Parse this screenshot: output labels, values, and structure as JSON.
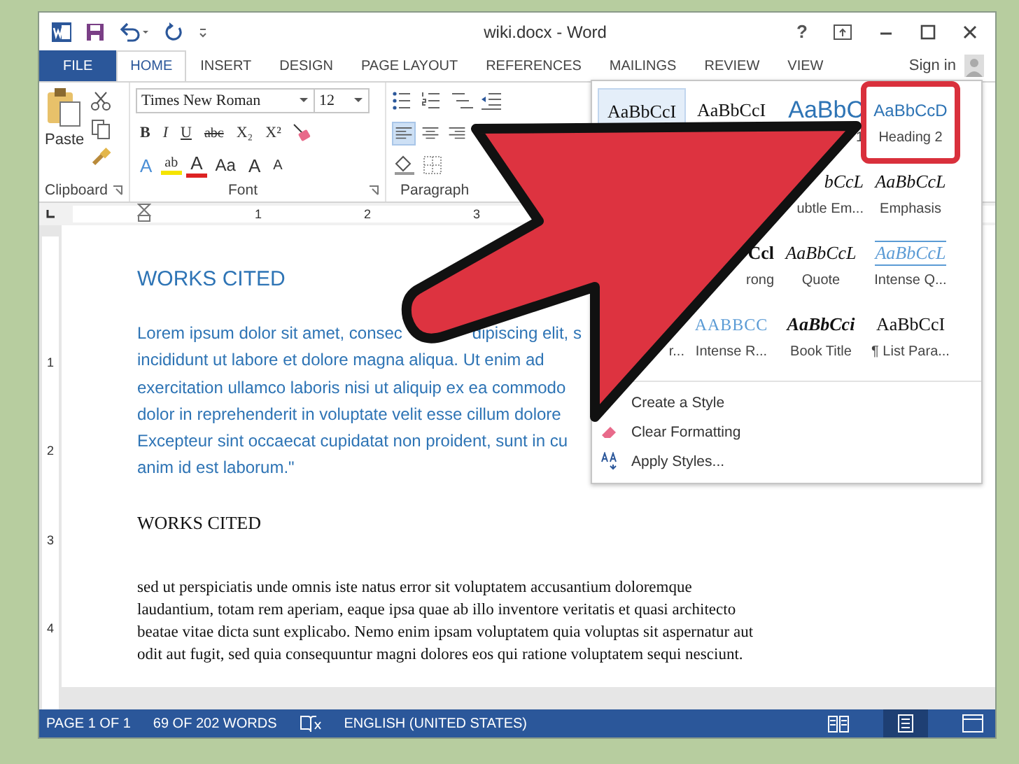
{
  "window": {
    "title": "wiki.docx - Word",
    "help": "?"
  },
  "tabs": [
    {
      "label": "FILE",
      "kind": "file",
      "selected": false
    },
    {
      "label": "HOME",
      "kind": "tab",
      "selected": true
    },
    {
      "label": "INSERT",
      "kind": "tab",
      "selected": false
    },
    {
      "label": "DESIGN",
      "kind": "tab",
      "selected": false
    },
    {
      "label": "PAGE LAYOUT",
      "kind": "tab",
      "selected": false
    },
    {
      "label": "REFERENCES",
      "kind": "tab",
      "selected": false
    },
    {
      "label": "MAILINGS",
      "kind": "tab",
      "selected": false
    },
    {
      "label": "REVIEW",
      "kind": "tab",
      "selected": false
    },
    {
      "label": "VIEW",
      "kind": "tab",
      "selected": false
    }
  ],
  "sign_in": "Sign in",
  "clipboard": {
    "paste": "Paste",
    "label": "Clipboard"
  },
  "font": {
    "family": "Times New Roman",
    "size": "12",
    "label": "Font",
    "format_buttons": [
      {
        "text": "B",
        "kind": "bold"
      },
      {
        "text": "I",
        "kind": "italic"
      },
      {
        "text": "U",
        "kind": "underline"
      },
      {
        "text": "abc",
        "kind": "strike"
      },
      {
        "text": "X₂",
        "kind": "sub"
      },
      {
        "text": "X²",
        "kind": "sup"
      }
    ],
    "effect_buttons": [
      {
        "text": "A",
        "kind": "effects"
      },
      {
        "text": "ab",
        "kind": "highlight"
      },
      {
        "text": "A",
        "kind": "color"
      },
      {
        "text": "Aa",
        "kind": "case"
      },
      {
        "text": "A",
        "kind": "grow"
      },
      {
        "text": "A",
        "kind": "shrink"
      }
    ]
  },
  "paragraph": {
    "label": "Paragraph",
    "alignments": [
      {
        "kind": "left",
        "selected": true
      },
      {
        "kind": "center",
        "selected": false
      },
      {
        "kind": "right",
        "selected": false
      }
    ]
  },
  "ruler": {
    "marks": [
      "1",
      "2",
      "3"
    ]
  },
  "vertical_ruler": {
    "marks": [
      "1",
      "2",
      "3",
      "4"
    ]
  },
  "document": {
    "heading": "WORKS CITED",
    "paragraph_lines": [
      [
        "Lorem ipsum dolor sit amet, consec",
        "dipiscing elit, s"
      ],
      [
        "incididunt ut labore et dolore magna aliqua. Ut enim ad"
      ],
      [
        "exercitation ullamco laboris nisi ut aliquip ex ea commodo"
      ],
      [
        "dolor in reprehenderit in voluptate velit esse cillum dolore"
      ],
      [
        "Excepteur sint occaecat cupidatat non proident, sunt in cu"
      ],
      [
        "anim id est laborum.\""
      ]
    ],
    "heading_2": "WORKS CITED",
    "body_lines": [
      "sed ut perspiciatis unde omnis iste natus error sit voluptatem accusantium doloremque",
      "laudantium, totam rem aperiam, eaque ipsa quae ab illo inventore veritatis et quasi architecto",
      "beatae vitae dicta sunt explicabo. Nemo enim ipsam voluptatem quia voluptas sit aspernatur aut",
      "odit aut fugit, sed quia consequuntur magni dolores eos qui ratione voluptatem sequi nesciunt."
    ]
  },
  "styles_gallery": {
    "rows": [
      [
        {
          "sample": "AaBbCcI",
          "kind": "normal",
          "selected": true,
          "highlighted": false,
          "cut": false
        },
        {
          "sample": "AaBbCcI",
          "kind": "normal",
          "selected": false,
          "highlighted": false,
          "cut": false
        },
        {
          "sample": "AaBbC",
          "label": "1",
          "kind": "heading1",
          "selected": false,
          "highlighted": false,
          "cut": true
        },
        {
          "sample": "AaBbCcD",
          "label": "Heading 2",
          "kind": "heading2",
          "selected": false,
          "highlighted": true,
          "cut": false
        }
      ],
      [
        null,
        null,
        {
          "sample": "bCcL",
          "label": "ubtle Em...",
          "kind": "emphasis",
          "selected": false,
          "highlighted": false,
          "cut": true
        },
        {
          "sample": "AaBbCcL",
          "label": "Emphasis",
          "kind": "emphasis",
          "selected": false,
          "highlighted": false,
          "cut": false
        }
      ],
      [
        null,
        {
          "sample": "Ccl",
          "label": "rong",
          "kind": "strong",
          "selected": false,
          "highlighted": false,
          "cut": true
        },
        {
          "sample": "AaBbCcL",
          "label": "Quote",
          "kind": "emphasis",
          "selected": false,
          "highlighted": false,
          "cut": false
        },
        {
          "sample": "AaBbCcL",
          "label": "Intense Q...",
          "kind": "intense_quote",
          "selected": false,
          "highlighted": false,
          "cut": false
        }
      ],
      [
        {
          "label": "r...",
          "kind": "normal",
          "selected": false,
          "highlighted": false,
          "cut": true
        },
        {
          "sample": "AABBCC",
          "label": "Intense R...",
          "kind": "intense_ref",
          "selected": false,
          "highlighted": false,
          "cut": false
        },
        {
          "sample": "AaBbCci",
          "label": "Book Title",
          "kind": "book_title",
          "selected": false,
          "highlighted": false,
          "cut": false
        },
        {
          "sample": "AaBbCcI",
          "label": "¶ List Para...",
          "kind": "normal",
          "selected": false,
          "highlighted": false,
          "cut": false
        }
      ]
    ],
    "menu": [
      {
        "label": "Create a Style",
        "kind": "create"
      },
      {
        "label": "Clear Formatting",
        "kind": "clear"
      },
      {
        "label": "Apply Styles...",
        "kind": "apply"
      }
    ]
  },
  "status_bar": {
    "page": "PAGE 1 OF 1",
    "words": "69 OF 202 WORDS",
    "language": "ENGLISH (UNITED STATES)",
    "views": [
      {
        "kind": "read",
        "selected": false
      },
      {
        "kind": "print",
        "selected": true
      },
      {
        "kind": "web",
        "selected": false
      }
    ]
  }
}
